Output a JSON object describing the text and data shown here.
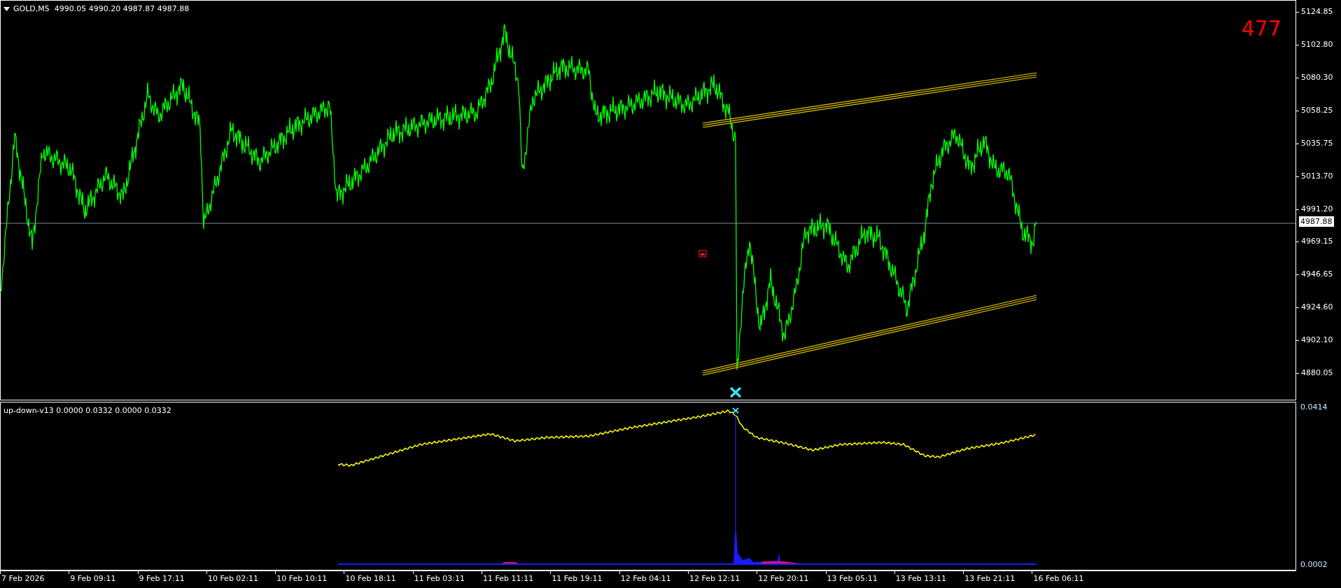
{
  "main_chart": {
    "header": "GOLD,M5  4990.05 4990.20 4987.87 4987.88",
    "counter": "477"
  },
  "price_axis": {
    "labels": [
      "5124.85",
      "5102.80",
      "5080.30",
      "5058.25",
      "5035.75",
      "5013.70",
      "4991.20",
      "4969.15",
      "4946.65",
      "4924.60",
      "4902.10",
      "4880.05"
    ],
    "current_price": "4987.88"
  },
  "indicator": {
    "label": "up-down-v13 0.0000 0.0332 0.0000 0.0332",
    "axis_labels": [
      "0.0414",
      "0.0002"
    ]
  },
  "time_axis": {
    "labels": [
      "7 Feb 2026",
      "9 Feb 09:11",
      "9 Feb 17:11",
      "10 Feb 02:11",
      "10 Feb 10:11",
      "10 Feb 18:11",
      "11 Feb 03:11",
      "11 Feb 11:11",
      "11 Feb 19:11",
      "12 Feb 04:11",
      "12 Feb 12:11",
      "12 Feb 20:11",
      "13 Feb 05:11",
      "13 Feb 13:11",
      "13 Feb 21:11",
      "16 Feb 06:11"
    ]
  }
}
